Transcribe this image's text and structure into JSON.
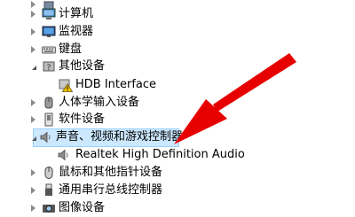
{
  "tree": {
    "items": [
      {
        "label": "",
        "icon": "generic-device-icon"
      },
      {
        "label": "计算机",
        "icon": "computer-icon"
      },
      {
        "label": "监视器",
        "icon": "monitor-icon"
      },
      {
        "label": "键盘",
        "icon": "keyboard-icon"
      },
      {
        "label": "其他设备",
        "icon": "unknown-device-icon"
      },
      {
        "label": "HDB Interface",
        "icon": "warning-device-icon"
      },
      {
        "label": "人体学输入设备",
        "icon": "hid-icon"
      },
      {
        "label": "软件设备",
        "icon": "software-device-icon"
      },
      {
        "label": "声音、视频和游戏控制器",
        "icon": "speaker-icon"
      },
      {
        "label": "Realtek High Definition Audio",
        "icon": "speaker-icon"
      },
      {
        "label": "鼠标和其他指针设备",
        "icon": "mouse-icon"
      },
      {
        "label": "通用串行总线控制器",
        "icon": "usb-icon"
      },
      {
        "label": "图像设备",
        "icon": "camera-icon"
      }
    ]
  },
  "annotation": {
    "color": "#e60000",
    "icon": "red-arrow"
  }
}
